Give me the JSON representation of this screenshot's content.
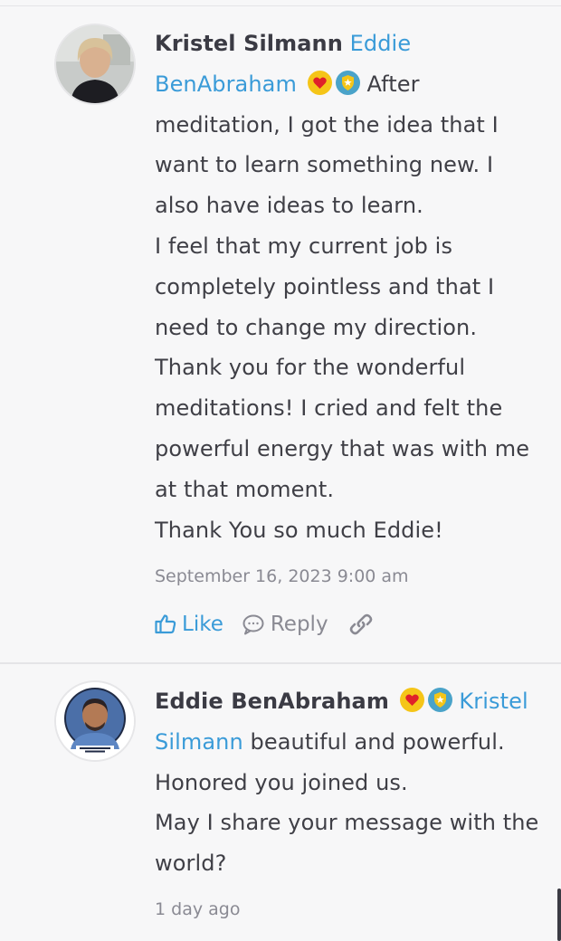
{
  "comments": [
    {
      "author": "Kristel Silmann",
      "mention": "Eddie BenAbraham",
      "text_first": "After meditation, I got the idea that I want to learn something new. I also have ideas to learn.",
      "paragraphs": [
        "I feel that my current job is completely pointless and that I need to change my direction.",
        "Thank you for the wonderful meditations! I cried and felt the powerful energy that was with me at that moment.",
        "Thank You so much Eddie!"
      ],
      "timestamp": "September 16, 2023 9:00 am",
      "actions": {
        "like_label": "Like",
        "reply_label": "Reply"
      }
    },
    {
      "author": "Eddie BenAbraham",
      "mention": "Kristel Silmann",
      "text_first": "beautiful and powerful.",
      "paragraphs": [
        "Honored you joined us.",
        "May I share your message with the world?"
      ],
      "timestamp": "1 day ago"
    }
  ],
  "icons": {
    "heart_badge": "heart-badge-icon",
    "shield_badge": "shield-badge-icon",
    "like": "thumbs-up-icon",
    "reply": "speech-bubble-icon",
    "link": "link-icon"
  },
  "colors": {
    "mention": "#3a9bd8",
    "text": "#3f3f46",
    "muted": "#8a8a93",
    "background": "#f7f7f8",
    "badge_gold": "#f5c518",
    "badge_teal": "#4aa3c9",
    "heart_red": "#e0202a"
  }
}
